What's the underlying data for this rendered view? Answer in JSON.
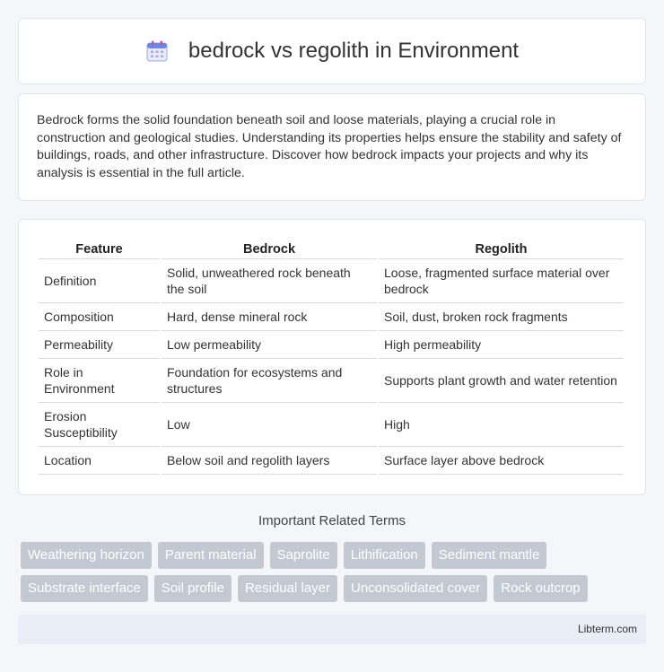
{
  "header": {
    "title": "bedrock vs regolith in Environment",
    "icon": "calendar-icon"
  },
  "intro": {
    "text": "Bedrock forms the solid foundation beneath soil and loose materials, playing a crucial role in construction and geological studies. Understanding its properties helps ensure the stability and safety of buildings, roads, and other infrastructure. Discover how bedrock impacts your projects and why its analysis is essential in the full article."
  },
  "table": {
    "headers": [
      "Feature",
      "Bedrock",
      "Regolith"
    ],
    "rows": [
      [
        "Definition",
        "Solid, unweathered rock beneath the soil",
        "Loose, fragmented surface material over bedrock"
      ],
      [
        "Composition",
        "Hard, dense mineral rock",
        "Soil, dust, broken rock fragments"
      ],
      [
        "Permeability",
        "Low permeability",
        "High permeability"
      ],
      [
        "Role in Environment",
        "Foundation for ecosystems and structures",
        "Supports plant growth and water retention"
      ],
      [
        "Erosion Susceptibility",
        "Low",
        "High"
      ],
      [
        "Location",
        "Below soil and regolith layers",
        "Surface layer above bedrock"
      ]
    ]
  },
  "terms": {
    "title": "Important Related Terms",
    "row1": [
      "Weathering horizon",
      "Parent material",
      "Saprolite",
      "Lithification",
      "Sediment mantle"
    ],
    "row2": [
      "Substrate interface",
      "Soil profile",
      "Residual layer",
      "Unconsolidated cover",
      "Rock outcrop"
    ]
  },
  "footer": {
    "text": "Libterm.com"
  }
}
